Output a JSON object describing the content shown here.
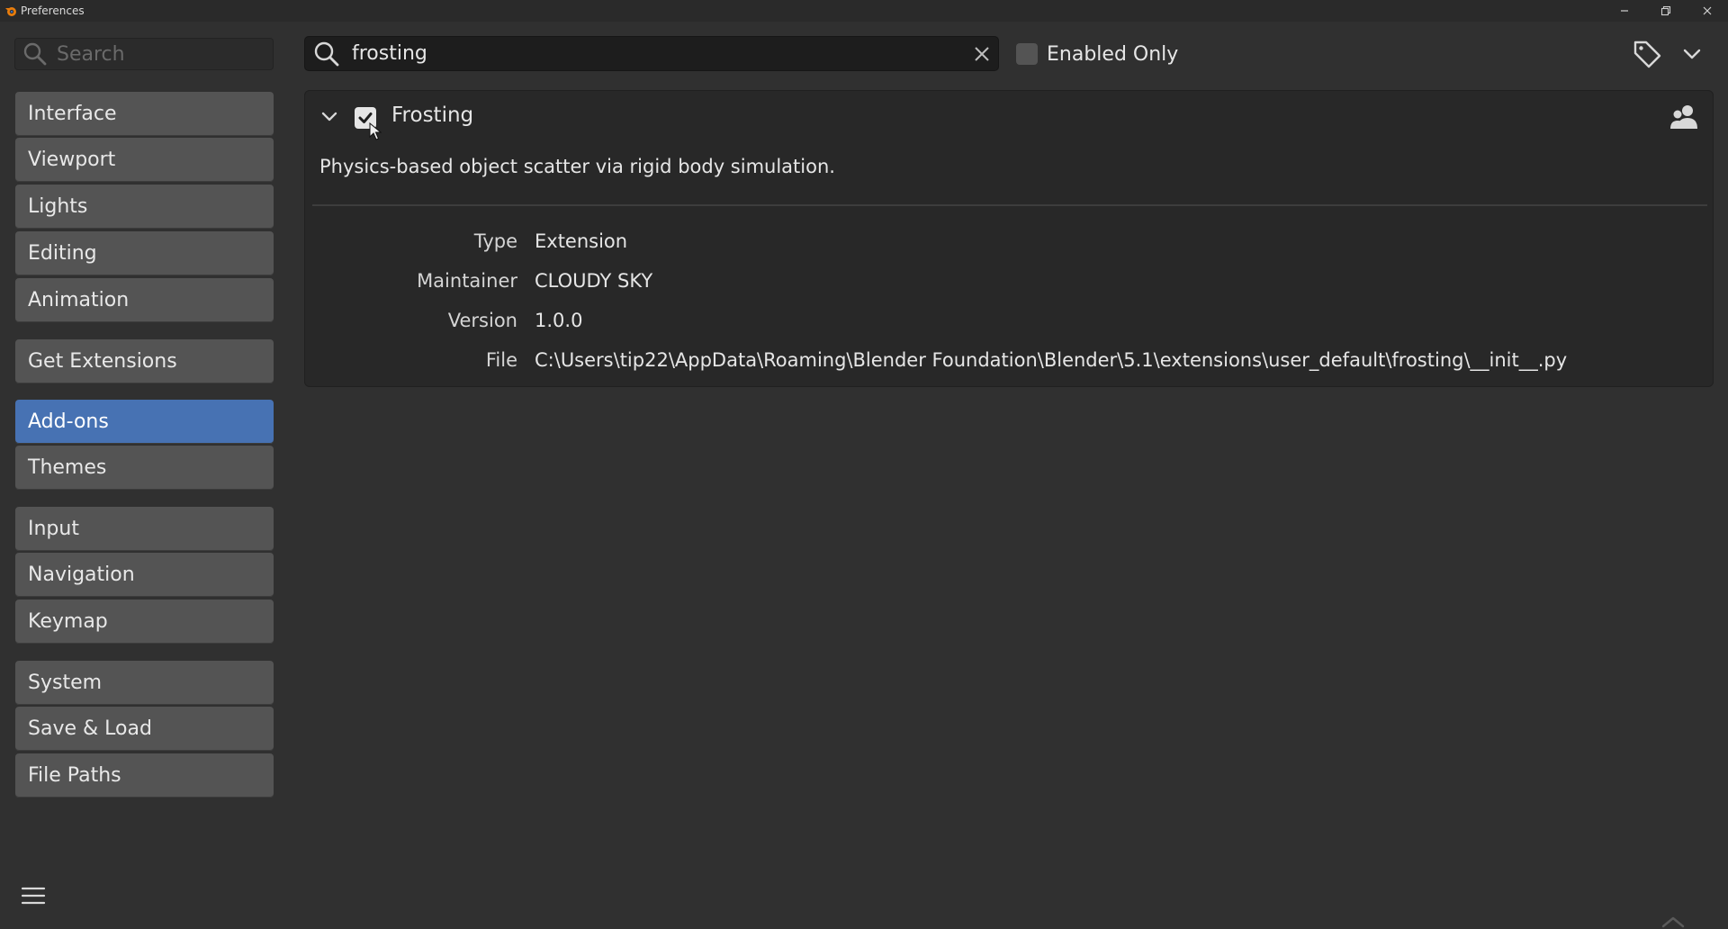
{
  "window": {
    "title": "Preferences",
    "controls": [
      "minimize-icon",
      "maximize-icon",
      "close-icon"
    ]
  },
  "sidebar": {
    "search_placeholder": "Search",
    "groups": [
      [
        "Interface",
        "Viewport",
        "Lights",
        "Editing",
        "Animation"
      ],
      [
        "Get Extensions"
      ],
      [
        "Add-ons",
        "Themes"
      ],
      [
        "Input",
        "Navigation",
        "Keymap"
      ],
      [
        "System",
        "Save & Load",
        "File Paths"
      ]
    ],
    "items": [
      {
        "label": "Interface"
      },
      {
        "label": "Viewport"
      },
      {
        "label": "Lights"
      },
      {
        "label": "Editing"
      },
      {
        "label": "Animation"
      },
      {
        "label": "Get Extensions"
      },
      {
        "label": "Add-ons",
        "active": true
      },
      {
        "label": "Themes"
      },
      {
        "label": "Input"
      },
      {
        "label": "Navigation"
      },
      {
        "label": "Keymap"
      },
      {
        "label": "System"
      },
      {
        "label": "Save & Load"
      },
      {
        "label": "File Paths"
      }
    ]
  },
  "toolbar": {
    "search_value": "frosting",
    "enabled_only_label": "Enabled Only",
    "enabled_only_checked": false
  },
  "addon": {
    "name": "Frosting",
    "enabled": true,
    "expanded": true,
    "description": "Physics-based object scatter via rigid body simulation.",
    "properties": [
      {
        "key": "Type",
        "value": "Extension"
      },
      {
        "key": "Maintainer",
        "value": "CLOUDY SKY"
      },
      {
        "key": "Version",
        "value": "1.0.0"
      },
      {
        "key": "File",
        "value": "C:\\Users\\tip22\\AppData\\Roaming\\Blender Foundation\\Blender\\5.1\\extensions\\user_default\\frosting\\__init__.py"
      }
    ]
  },
  "colors": {
    "background": "#303030",
    "button": "#545454",
    "accent": "#4772b3",
    "panel": "#282828",
    "search_field": "#1d1d1d"
  }
}
